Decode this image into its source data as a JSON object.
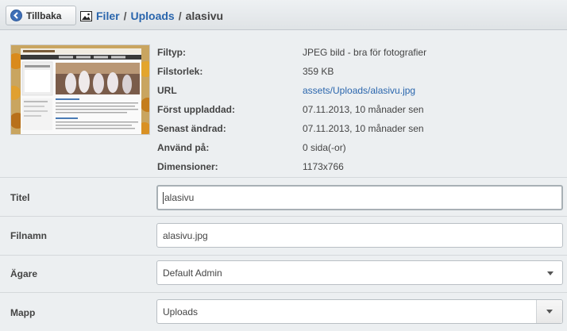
{
  "header": {
    "back_label": "Tillbaka",
    "crumbs": [
      "Filer",
      "Uploads"
    ],
    "separator": "/",
    "current": "alasivu"
  },
  "info": [
    {
      "label": "Filtyp:",
      "value": "JPEG bild - bra för fotografier"
    },
    {
      "label": "Filstorlek:",
      "value": "359 KB"
    },
    {
      "label": "URL",
      "value": "assets/Uploads/alasivu.jpg"
    },
    {
      "label": "Först uppladdad:",
      "value": "07.11.2013, 10 månader sen"
    },
    {
      "label": "Senast ändrad:",
      "value": "07.11.2013, 10 månader sen"
    },
    {
      "label": "Använd på:",
      "value": "0 sida(-or)"
    },
    {
      "label": "Dimensioner:",
      "value": "1173x766"
    }
  ],
  "form": {
    "title": {
      "label": "Titel",
      "value": "alasivu"
    },
    "filename": {
      "label": "Filnamn",
      "value": "alasivu.jpg"
    },
    "owner": {
      "label": "Ägare",
      "value": "Default Admin"
    },
    "folder": {
      "label": "Mapp",
      "value": "Uploads"
    }
  },
  "colors": {
    "link": "#2a66ad",
    "back_circle": "#3f6fb7"
  }
}
